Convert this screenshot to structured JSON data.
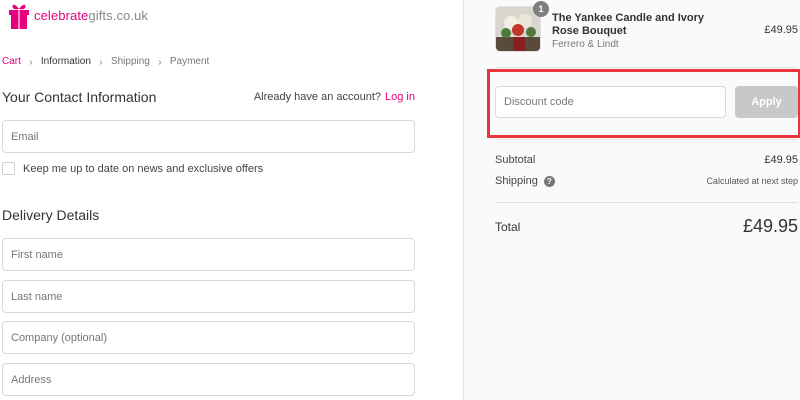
{
  "brand": {
    "logo_text_pink": "celebrate",
    "logo_text_gray": "gifts.co.uk",
    "accent": "#e6007e"
  },
  "breadcrumb": {
    "items": [
      {
        "label": "Cart"
      },
      {
        "label": "Information"
      },
      {
        "label": "Shipping"
      },
      {
        "label": "Payment"
      }
    ]
  },
  "contact": {
    "title": "Your Contact Information",
    "account_prompt": "Already have an account?",
    "login_label": "Log in",
    "email_placeholder": "Email",
    "newsletter_label": "Keep me up to date on news and exclusive offers"
  },
  "delivery": {
    "title": "Delivery Details",
    "first_name_placeholder": "First name",
    "last_name_placeholder": "Last name",
    "company_placeholder": "Company (optional)",
    "address_placeholder": "Address"
  },
  "order": {
    "product": {
      "quantity": "1",
      "name": "The Yankee Candle and Ivory Rose Bouquet",
      "brand": "Ferrero & Lindt",
      "price": "£49.95"
    },
    "discount_placeholder": "Discount code",
    "apply_label": "Apply",
    "subtotal_label": "Subtotal",
    "subtotal_value": "£49.95",
    "shipping_label": "Shipping",
    "shipping_value": "Calculated at next step",
    "total_label": "Total",
    "total_value": "£49.95"
  },
  "colors": {
    "highlight": "#e8343a",
    "apply_disabled": "#c8c8c8"
  }
}
